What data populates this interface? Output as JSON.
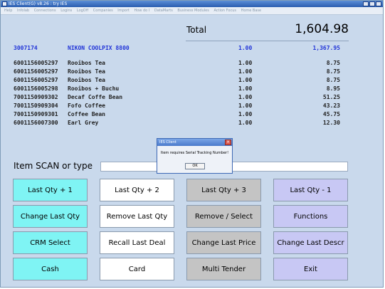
{
  "window": {
    "title": "IES Client(G) v8.26 : try IES"
  },
  "menu": [
    "Help",
    "Infolab",
    "Connections",
    "Logins",
    "LogOff",
    "Companies",
    "Import",
    "How do I",
    "DataMarts",
    "Business Modules",
    "Action Focus",
    "Home Base"
  ],
  "receipt": {
    "total_label": "Total",
    "total_value": "1,604.98",
    "lines": [
      {
        "code": "3007174",
        "desc": "NIKON COOLPIX 8800",
        "qty": "1.00",
        "amount": "1,367.95"
      },
      {
        "code": "6001156005297",
        "desc": "Rooibos Tea",
        "qty": "1.00",
        "amount": "8.75"
      },
      {
        "code": "6001156005297",
        "desc": "Rooibos Tea",
        "qty": "1.00",
        "amount": "8.75"
      },
      {
        "code": "6001156005297",
        "desc": "Rooibos Tea",
        "qty": "1.00",
        "amount": "8.75"
      },
      {
        "code": "6001156005298",
        "desc": "Rooibos + Buchu",
        "qty": "1.00",
        "amount": "8.95"
      },
      {
        "code": "7001150909302",
        "desc": "Decaf Coffe Bean",
        "qty": "1.00",
        "amount": "51.25"
      },
      {
        "code": "7001150909304",
        "desc": "Fofo Coffee",
        "qty": "1.00",
        "amount": "43.23"
      },
      {
        "code": "7001150909301",
        "desc": "Coffee Bean",
        "qty": "1.00",
        "amount": "45.75"
      },
      {
        "code": "6001156007300",
        "desc": "Earl Grey",
        "qty": "1.00",
        "amount": "12.30"
      }
    ]
  },
  "scan": {
    "label": "Item SCAN or type",
    "value": ""
  },
  "buttons": {
    "last_qty_plus_1": "Last Qty + 1",
    "last_qty_plus_2": "Last Qty + 2",
    "last_qty_plus_3": "Last Qty + 3",
    "last_qty_minus_1": "Last Qty - 1",
    "change_last_qty": "Change Last Qty",
    "remove_last_qty": "Remove Last Qty",
    "remove_select": "Remove / Select",
    "functions": "Functions",
    "crm_select": "CRM Select",
    "recall_last_deal": "Recall Last Deal",
    "change_last_price": "Change Last Price",
    "change_last_descr": "Change Last Descr",
    "cash": "Cash",
    "card": "Card",
    "multi_tender": "Multi Tender",
    "exit": "Exit"
  },
  "dialog": {
    "title": "IES Client",
    "message": "Item requires Serial Tracking Number!",
    "ok": "OK",
    "close": "×"
  },
  "colors": {
    "background": "#c9d9ec",
    "highlight_line": "#2235d8",
    "button_cyan": "#7ff4f4",
    "button_white": "#ffffff",
    "button_grey": "#c4c4c4",
    "button_lavender": "#c8c8f4"
  }
}
